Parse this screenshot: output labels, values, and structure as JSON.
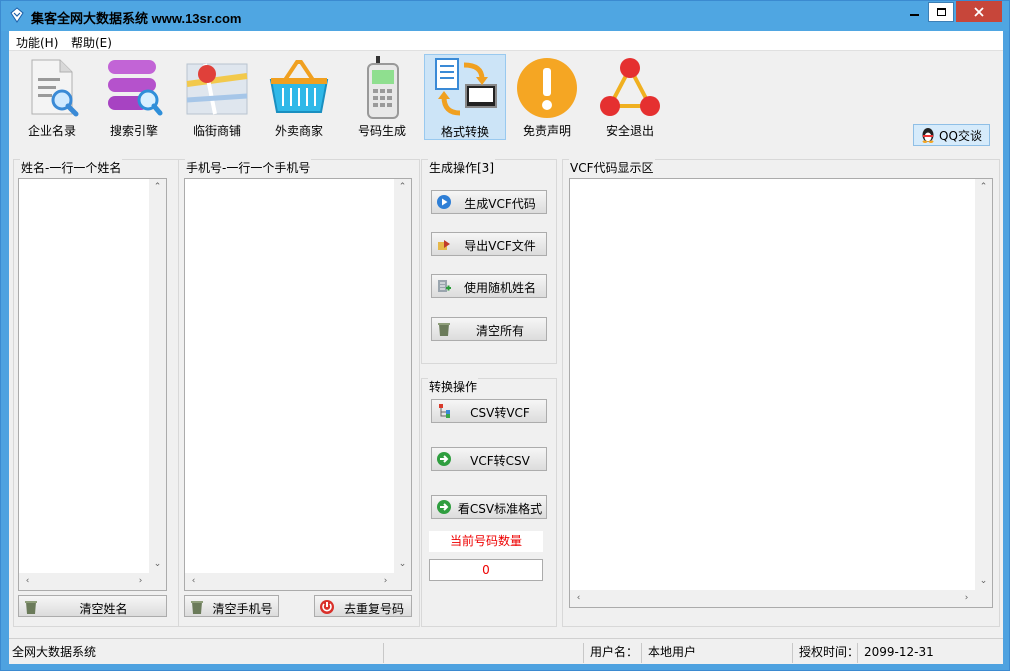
{
  "window": {
    "title": "集客全网大数据系统  www.13sr.com"
  },
  "menu": {
    "items": [
      "功能(H)",
      "帮助(E)"
    ]
  },
  "toolbar": {
    "items": [
      {
        "label": "企业名录",
        "icon": "document-search-icon"
      },
      {
        "label": "搜索引擎",
        "icon": "database-search-icon"
      },
      {
        "label": "临街商铺",
        "icon": "map-pin-icon"
      },
      {
        "label": "外卖商家",
        "icon": "basket-icon"
      },
      {
        "label": "号码生成",
        "icon": "phone-icon"
      },
      {
        "label": "格式转换",
        "icon": "convert-icon"
      },
      {
        "label": "免责声明",
        "icon": "warning-icon"
      },
      {
        "label": "安全退出",
        "icon": "network-icon"
      }
    ],
    "active_index": 5,
    "qq_label": "QQ交谈"
  },
  "panels": {
    "names": {
      "title": "姓名-一行一个姓名",
      "clear_label": "清空姓名"
    },
    "phones": {
      "title": "手机号-一行一个手机号",
      "clear_label": "清空手机号",
      "dedupe_label": "去重复号码"
    },
    "generate": {
      "title": "生成操作[3]",
      "buttons": [
        "生成VCF代码",
        "导出VCF文件",
        "使用随机姓名",
        "清空所有"
      ]
    },
    "convert": {
      "title": "转换操作",
      "buttons": [
        "CSV转VCF",
        "VCF转CSV",
        "看CSV标准格式"
      ]
    },
    "count_label": "当前号码数量",
    "count_value": "0",
    "vcf": {
      "title": "VCF代码显示区"
    }
  },
  "statusbar": {
    "app": "全网大数据系统",
    "user_label": "用户名：",
    "user_value": "本地用户",
    "auth_label": "授权时间：",
    "auth_value": "2099-12-31"
  },
  "colors": {
    "titlebar": "#4fa6e2",
    "close_button": "#c7463a",
    "count_text": "#e00000"
  }
}
